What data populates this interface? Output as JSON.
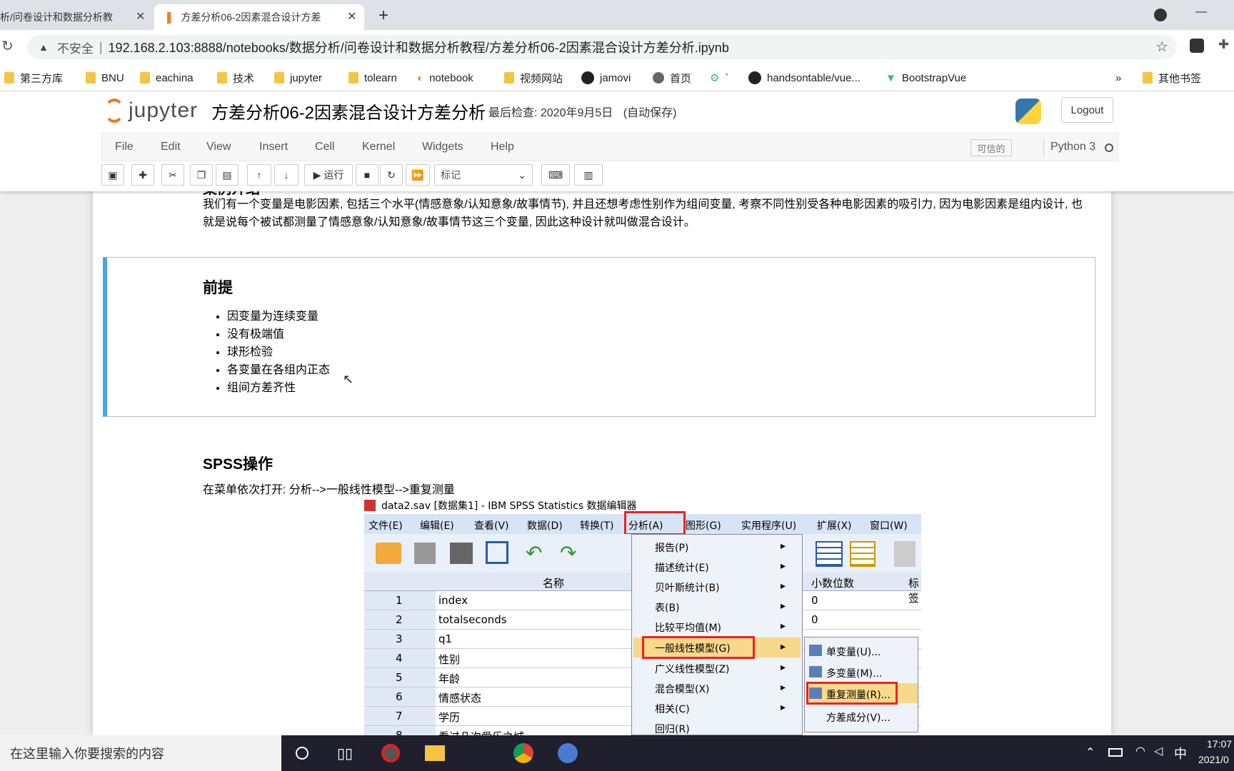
{
  "browser": {
    "tabs": [
      {
        "title": "析/问卷设计和数据分析教"
      },
      {
        "title": "方差分析06-2因素混合设计方差"
      }
    ],
    "url_warning": "不安全",
    "url": "192.168.2.103:8888/notebooks/数据分析/问卷设计和数据分析教程/方差分析06-2因素混合设计方差分析.ipynb",
    "bookmarks": [
      "第三方库",
      "BNU",
      "eachina",
      "技术",
      "jupyter",
      "tolearn",
      "notebook",
      "视频网站",
      "jamovi",
      "首页",
      "`",
      "handsontable/vue...",
      "BootstrapVue"
    ],
    "overflow": "»",
    "other_bookmarks": "其他书签"
  },
  "jupyter": {
    "logo": "jupyter",
    "title": "方差分析06-2因素混合设计方差分析",
    "checkpoint": "最后检查: 2020年9月5日",
    "autosave": "(自动保存)",
    "logout": "Logout",
    "menu": [
      "File",
      "Edit",
      "View",
      "Insert",
      "Cell",
      "Kernel",
      "Widgets",
      "Help"
    ],
    "trusted": "可信的",
    "kernel": "Python 3",
    "run_label": "运行",
    "cell_type": "标记"
  },
  "notebook": {
    "partial_heading": "案例介绍",
    "intro": "我们有一个变量是电影因素, 包括三个水平(情感意象/认知意象/故事情节), 并且还想考虑性别作为组间变量, 考察不同性别受各种电影因素的吸引力, 因为电影因素是组内设计, 也就是说每个被试都测量了情感意象/认知意象/故事情节这三个变量, 因此这种设计就叫做混合设计。",
    "premise_title": "前提",
    "premise_items": [
      "因变量为连续变量",
      "没有极端值",
      "球形检验",
      "各变量在各组内正态",
      "组间方差齐性"
    ],
    "spss_title": "SPSS操作",
    "spss_text": "在菜单依次打开: 分析-->一般线性模型-->重复测量"
  },
  "spss": {
    "title": "data2.sav [数据集1] - IBM SPSS Statistics 数据编辑器",
    "menu": [
      "文件(E)",
      "编辑(E)",
      "查看(V)",
      "数据(D)",
      "转换(T)",
      "分析(A)",
      "图形(G)",
      "实用程序(U)",
      "扩展(X)",
      "窗口(W)"
    ],
    "col_name": "名称",
    "col_decimals": "小数位数",
    "col_label": "标签",
    "rows": [
      {
        "n": "1",
        "name": "index",
        "dec": "0"
      },
      {
        "n": "2",
        "name": "totalseconds",
        "dec": "0"
      },
      {
        "n": "3",
        "name": "q1",
        "dec": ""
      },
      {
        "n": "4",
        "name": "性别",
        "dec": ""
      },
      {
        "n": "5",
        "name": "年龄",
        "dec": ""
      },
      {
        "n": "6",
        "name": "情感状态",
        "dec": ""
      },
      {
        "n": "7",
        "name": "学历",
        "dec": ""
      },
      {
        "n": "8",
        "name": "看过几次爱乐之城",
        "dec": ""
      }
    ],
    "analyze_menu": [
      "报告(P)",
      "描述统计(E)",
      "贝叶斯统计(B)",
      "表(B)",
      "比较平均值(M)",
      "一般线性模型(G)",
      "广义线性模型(Z)",
      "混合模型(X)",
      "相关(C)",
      "回归(R)"
    ],
    "glm_submenu": [
      "单变量(U)...",
      "多变量(M)...",
      "重复测量(R)...",
      "方差成分(V)..."
    ]
  },
  "taskbar": {
    "search": "在这里输入你要搜索的内容",
    "ime": "中",
    "time": "17:07",
    "date": "2021/0"
  }
}
